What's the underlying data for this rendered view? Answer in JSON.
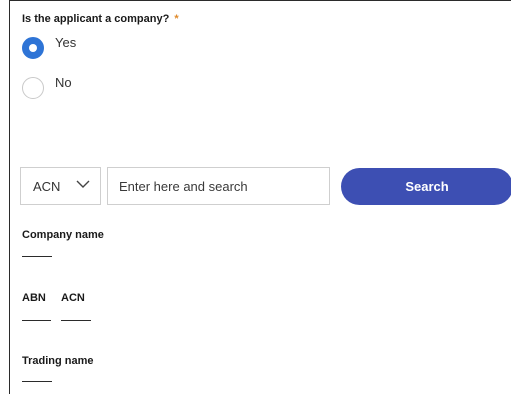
{
  "question": {
    "label": "Is the applicant a company?",
    "required_mark": "*"
  },
  "options": [
    {
      "label": "Yes",
      "selected": true
    },
    {
      "label": "No",
      "selected": false
    }
  ],
  "search": {
    "type_selected": "ACN",
    "placeholder": "Enter here and search",
    "button_label": "Search"
  },
  "fields": {
    "company_name_label": "Company name",
    "abn_label": "ABN",
    "acn_label": "ACN",
    "trading_name_label": "Trading name"
  },
  "colors": {
    "accent": "#3d4fb3",
    "radio_selected": "#2e74d6",
    "required": "#e08a2a"
  }
}
